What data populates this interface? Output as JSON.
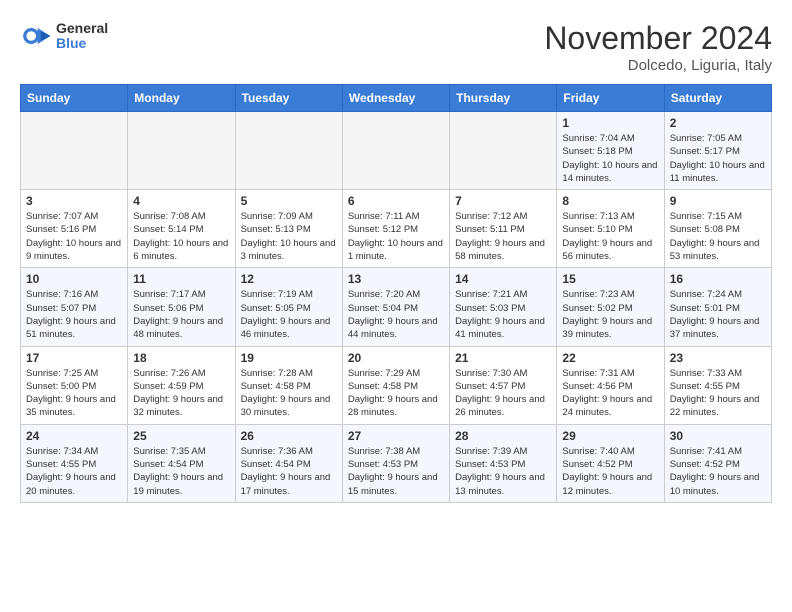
{
  "header": {
    "logo_general": "General",
    "logo_blue": "Blue",
    "month_title": "November 2024",
    "location": "Dolcedo, Liguria, Italy"
  },
  "days_of_week": [
    "Sunday",
    "Monday",
    "Tuesday",
    "Wednesday",
    "Thursday",
    "Friday",
    "Saturday"
  ],
  "weeks": [
    [
      {
        "day": "",
        "info": ""
      },
      {
        "day": "",
        "info": ""
      },
      {
        "day": "",
        "info": ""
      },
      {
        "day": "",
        "info": ""
      },
      {
        "day": "",
        "info": ""
      },
      {
        "day": "1",
        "info": "Sunrise: 7:04 AM\nSunset: 5:18 PM\nDaylight: 10 hours and 14 minutes."
      },
      {
        "day": "2",
        "info": "Sunrise: 7:05 AM\nSunset: 5:17 PM\nDaylight: 10 hours and 11 minutes."
      }
    ],
    [
      {
        "day": "3",
        "info": "Sunrise: 7:07 AM\nSunset: 5:16 PM\nDaylight: 10 hours and 9 minutes."
      },
      {
        "day": "4",
        "info": "Sunrise: 7:08 AM\nSunset: 5:14 PM\nDaylight: 10 hours and 6 minutes."
      },
      {
        "day": "5",
        "info": "Sunrise: 7:09 AM\nSunset: 5:13 PM\nDaylight: 10 hours and 3 minutes."
      },
      {
        "day": "6",
        "info": "Sunrise: 7:11 AM\nSunset: 5:12 PM\nDaylight: 10 hours and 1 minute."
      },
      {
        "day": "7",
        "info": "Sunrise: 7:12 AM\nSunset: 5:11 PM\nDaylight: 9 hours and 58 minutes."
      },
      {
        "day": "8",
        "info": "Sunrise: 7:13 AM\nSunset: 5:10 PM\nDaylight: 9 hours and 56 minutes."
      },
      {
        "day": "9",
        "info": "Sunrise: 7:15 AM\nSunset: 5:08 PM\nDaylight: 9 hours and 53 minutes."
      }
    ],
    [
      {
        "day": "10",
        "info": "Sunrise: 7:16 AM\nSunset: 5:07 PM\nDaylight: 9 hours and 51 minutes."
      },
      {
        "day": "11",
        "info": "Sunrise: 7:17 AM\nSunset: 5:06 PM\nDaylight: 9 hours and 48 minutes."
      },
      {
        "day": "12",
        "info": "Sunrise: 7:19 AM\nSunset: 5:05 PM\nDaylight: 9 hours and 46 minutes."
      },
      {
        "day": "13",
        "info": "Sunrise: 7:20 AM\nSunset: 5:04 PM\nDaylight: 9 hours and 44 minutes."
      },
      {
        "day": "14",
        "info": "Sunrise: 7:21 AM\nSunset: 5:03 PM\nDaylight: 9 hours and 41 minutes."
      },
      {
        "day": "15",
        "info": "Sunrise: 7:23 AM\nSunset: 5:02 PM\nDaylight: 9 hours and 39 minutes."
      },
      {
        "day": "16",
        "info": "Sunrise: 7:24 AM\nSunset: 5:01 PM\nDaylight: 9 hours and 37 minutes."
      }
    ],
    [
      {
        "day": "17",
        "info": "Sunrise: 7:25 AM\nSunset: 5:00 PM\nDaylight: 9 hours and 35 minutes."
      },
      {
        "day": "18",
        "info": "Sunrise: 7:26 AM\nSunset: 4:59 PM\nDaylight: 9 hours and 32 minutes."
      },
      {
        "day": "19",
        "info": "Sunrise: 7:28 AM\nSunset: 4:58 PM\nDaylight: 9 hours and 30 minutes."
      },
      {
        "day": "20",
        "info": "Sunrise: 7:29 AM\nSunset: 4:58 PM\nDaylight: 9 hours and 28 minutes."
      },
      {
        "day": "21",
        "info": "Sunrise: 7:30 AM\nSunset: 4:57 PM\nDaylight: 9 hours and 26 minutes."
      },
      {
        "day": "22",
        "info": "Sunrise: 7:31 AM\nSunset: 4:56 PM\nDaylight: 9 hours and 24 minutes."
      },
      {
        "day": "23",
        "info": "Sunrise: 7:33 AM\nSunset: 4:55 PM\nDaylight: 9 hours and 22 minutes."
      }
    ],
    [
      {
        "day": "24",
        "info": "Sunrise: 7:34 AM\nSunset: 4:55 PM\nDaylight: 9 hours and 20 minutes."
      },
      {
        "day": "25",
        "info": "Sunrise: 7:35 AM\nSunset: 4:54 PM\nDaylight: 9 hours and 19 minutes."
      },
      {
        "day": "26",
        "info": "Sunrise: 7:36 AM\nSunset: 4:54 PM\nDaylight: 9 hours and 17 minutes."
      },
      {
        "day": "27",
        "info": "Sunrise: 7:38 AM\nSunset: 4:53 PM\nDaylight: 9 hours and 15 minutes."
      },
      {
        "day": "28",
        "info": "Sunrise: 7:39 AM\nSunset: 4:53 PM\nDaylight: 9 hours and 13 minutes."
      },
      {
        "day": "29",
        "info": "Sunrise: 7:40 AM\nSunset: 4:52 PM\nDaylight: 9 hours and 12 minutes."
      },
      {
        "day": "30",
        "info": "Sunrise: 7:41 AM\nSunset: 4:52 PM\nDaylight: 9 hours and 10 minutes."
      }
    ]
  ]
}
